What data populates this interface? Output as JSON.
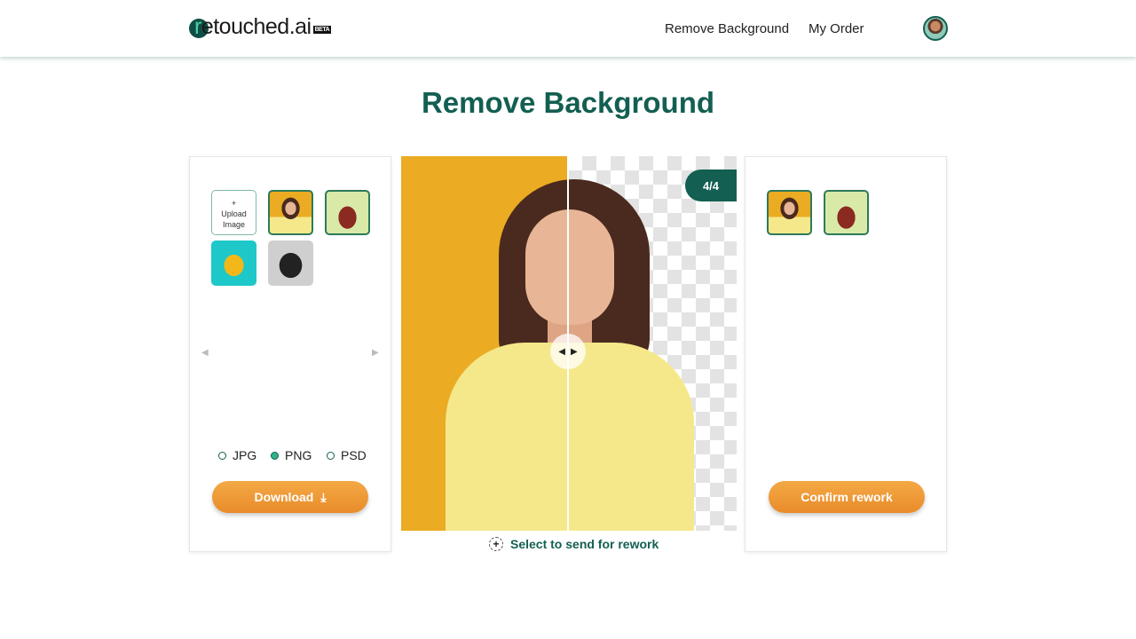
{
  "header": {
    "logo_text": "retouched.ai",
    "logo_badge": "BETA",
    "nav": [
      "Remove Background",
      "My Order"
    ],
    "avatar_icon": "user-avatar"
  },
  "page_title": "Remove Background",
  "left_panel": {
    "upload_plus": "+",
    "upload_label": "Upload Image",
    "thumbnails": [
      "woman-yellow-bg",
      "handbag",
      "sneaker",
      "tshirt"
    ],
    "formats": [
      {
        "label": "JPG",
        "selected": false
      },
      {
        "label": "PNG",
        "selected": true
      },
      {
        "label": "PSD",
        "selected": false
      }
    ],
    "download_label": "Download"
  },
  "viewer": {
    "counter": "4/4",
    "rework_label": "Select to send for rework"
  },
  "right_panel": {
    "thumbnails": [
      "woman-yellow-bg",
      "handbag"
    ],
    "confirm_label": "Confirm rework"
  },
  "colors": {
    "brand": "#135f52",
    "accent": "#ee9a35"
  }
}
